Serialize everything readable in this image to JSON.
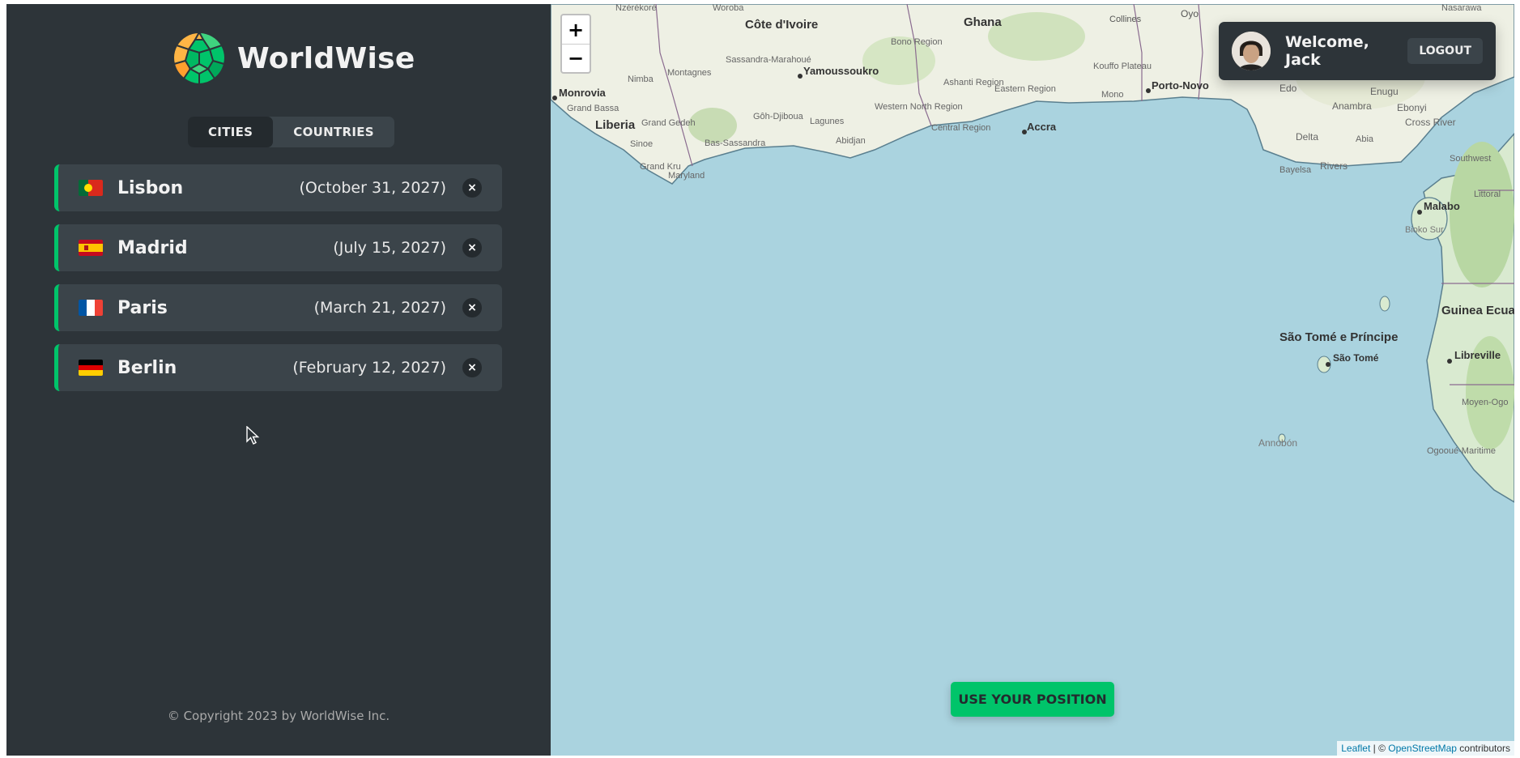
{
  "brand": {
    "name": "WorldWise"
  },
  "tabs": [
    {
      "label": "CITIES",
      "active": true
    },
    {
      "label": "COUNTRIES",
      "active": false
    }
  ],
  "cities": [
    {
      "name": "Lisbon",
      "date": "(October 31, 2027)",
      "flag": "portugal-flag-icon",
      "delete": "×"
    },
    {
      "name": "Madrid",
      "date": "(July 15, 2027)",
      "flag": "spain-flag-icon",
      "delete": "×"
    },
    {
      "name": "Paris",
      "date": "(March 21, 2027)",
      "flag": "france-flag-icon",
      "delete": "×"
    },
    {
      "name": "Berlin",
      "date": "(February 12, 2027)",
      "flag": "germany-flag-icon",
      "delete": "×"
    }
  ],
  "footer": {
    "copyright": "© Copyright 2023 by WorldWise Inc."
  },
  "map": {
    "zoom_in": "+",
    "zoom_out": "−",
    "labels": {
      "cote_divoire": "Côte d'Ivoire",
      "ghana": "Ghana",
      "oyo": "Oyo",
      "collines": "Collines",
      "yamoussoukro": "Yamoussoukro",
      "monrovia": "Monrovia",
      "liberia": "Liberia",
      "accra": "Accra",
      "porto_novo": "Porto-Novo",
      "malabo": "Malabo",
      "sao_tome_principe": "São Tomé e Príncipe",
      "sao_tome": "São Tomé",
      "libreville": "Libreville",
      "guinea_ecua": "Guinea Ecua",
      "annobon": "Annobón",
      "nasarawa": "Nasarawa",
      "edo": "Edo",
      "enugu": "Enugu",
      "ebonyi": "Ebonyi",
      "anambra": "Anambra",
      "abia": "Abia",
      "delta": "Delta",
      "cross_river": "Cross River",
      "bayelsa": "Bayelsa",
      "rivers": "Rivers",
      "southwest": "Southwest",
      "littoral": "Littoral",
      "bioko_sur": "Bioko Sur",
      "nimba": "Nimba",
      "grand_bassa": "Grand Bassa",
      "sinoe": "Sinoe",
      "grand_kru": "Grand Kru",
      "maryland": "Maryland",
      "grand_gedeh": "Grand Gedeh",
      "montagnes": "Montagnes",
      "sassandra_marahoue": "Sassandra-Marahoué",
      "goh_djiboua": "Gôh-Djiboua",
      "bas_sassandra": "Bas-Sassandra",
      "lagunes": "Lagunes",
      "abidjan": "Abidjan",
      "central_region": "Central Region",
      "western_north_region": "Western North Region",
      "eastern_region": "Eastern Region",
      "ashanti_region": "Ashanti Region",
      "bono_region": "Bono Region",
      "mono": "Mono",
      "kouffo_plateau": "Kouffo Plateau",
      "nzerekore": "Nzérékoré",
      "moyen_ogo": "Moyen-Ogo",
      "ogooue_maritime": "Ogooué-Maritime",
      "woroba": "Woroba"
    }
  },
  "user": {
    "welcome": "Welcome, Jack",
    "logout": "LOGOUT"
  },
  "position_button": "USE YOUR POSITION",
  "attribution": {
    "leaflet": "Leaflet",
    "sep": " | © ",
    "osm": "OpenStreetMap",
    "contributors": " contributors"
  }
}
